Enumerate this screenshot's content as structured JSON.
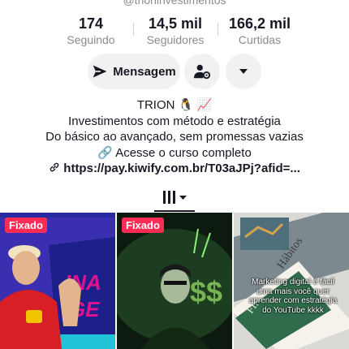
{
  "profile": {
    "handle": "@trioninvestimentos",
    "stats": [
      {
        "value": "174",
        "label": "Seguindo"
      },
      {
        "value": "14,5 mil",
        "label": "Seguidores"
      },
      {
        "value": "166,2 mil",
        "label": "Curtidas"
      }
    ],
    "buttons": {
      "message": "Mensagem",
      "add_friend_icon": "person-gear-icon",
      "more_icon": "caret-down-icon"
    },
    "bio": {
      "name": "TRION",
      "name_emojis": "🐧 📈",
      "lines": [
        "Investimentos com método e estratégia",
        "Do básico ao avançado, sem promessas vazias",
        "🔗 Acesse o curso completo"
      ],
      "link": "https://pay.kiwify.com.br/T03aJPj?afid=..."
    }
  },
  "tabs": {
    "active_icon": "grid-icon",
    "dropdown_icon": "caret-down-icon"
  },
  "videos": [
    {
      "pinned_label": "Fixado",
      "caption": ""
    },
    {
      "pinned_label": "Fixado",
      "caption": ""
    },
    {
      "pinned_label": "",
      "caption": "Marketing digital é fácil uma mais você quer aprender com estratégia do YouTube kkkk"
    }
  ],
  "colors": {
    "accent": "#fe2c55",
    "text": "#161823",
    "muted": "#8a8b91",
    "button_bg": "#f1f1f2"
  }
}
